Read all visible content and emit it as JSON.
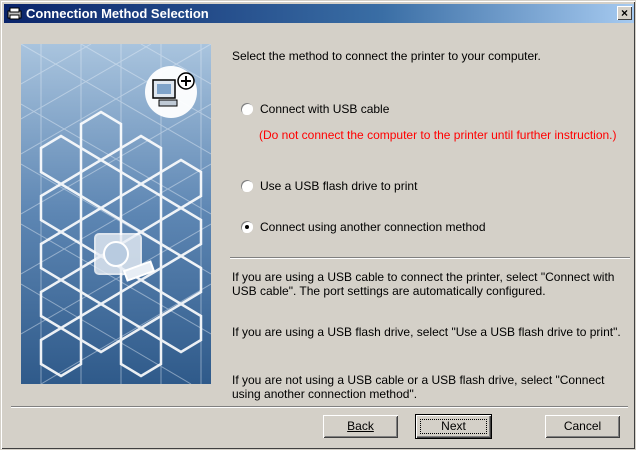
{
  "window": {
    "title": "Connection Method Selection",
    "close_label": "×"
  },
  "intro": "Select the method to connect the printer to your computer.",
  "options": [
    {
      "label": "Connect with USB cable",
      "selected": false
    },
    {
      "label": "Use a USB flash drive to print",
      "selected": false
    },
    {
      "label": "Connect using another connection method",
      "selected": true
    }
  ],
  "warning": "(Do not connect the computer to the printer until further instruction.)",
  "help": [
    "If you are using a USB cable to connect the printer, select \"Connect with USB cable\". The port settings are automatically configured.",
    "If you are using a USB flash drive, select \"Use a USB flash drive to print\".",
    "If you are not using a USB cable or a USB flash drive, select \"Connect using another connection method\"."
  ],
  "buttons": {
    "back": "Back",
    "next": "Next",
    "cancel": "Cancel"
  },
  "icons": {
    "app": "printer-setup-icon",
    "graphic_top": "computer-add-icon",
    "graphic_center": "printer-icon"
  }
}
